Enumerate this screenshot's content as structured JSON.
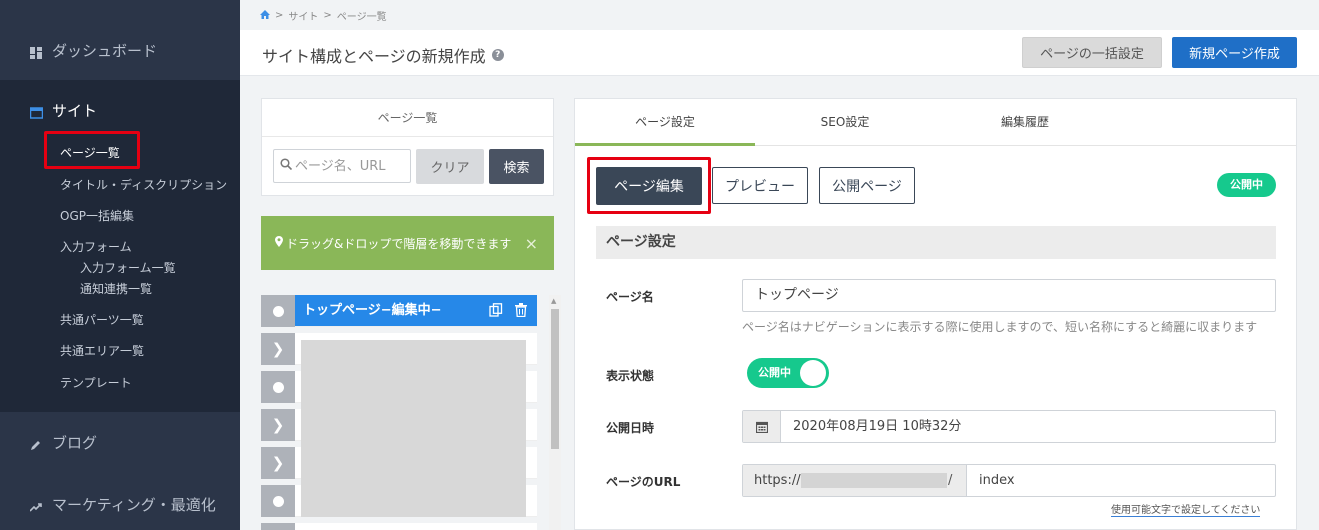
{
  "sidebar": {
    "dashboard": "ダッシュボード",
    "site": "サイト",
    "items": [
      {
        "label": "ページ一覧"
      },
      {
        "label": "タイトル・ディスクリプション"
      },
      {
        "label": "OGP一括編集"
      },
      {
        "label": "入力フォーム"
      },
      {
        "label": "入力フォーム一覧"
      },
      {
        "label": "通知連携一覧"
      },
      {
        "label": "共通パーツ一覧"
      },
      {
        "label": "共通エリア一覧"
      },
      {
        "label": "テンプレート"
      }
    ],
    "blog": "ブログ",
    "marketing": "マーケティング・最適化"
  },
  "breadcrumb": {
    "sep": ">",
    "site": "サイト",
    "current": "ページ一覧"
  },
  "header": {
    "title": "サイト構成とページの新規作成",
    "help": "?",
    "bulk_button": "ページの一括設定",
    "new_button": "新規ページ作成"
  },
  "page_list": {
    "title": "ページ一覧",
    "search_placeholder": "ページ名、URL",
    "clear_button": "クリア",
    "search_button": "検索"
  },
  "alert": {
    "text": "ドラッグ&ドロップで階層を移動できます",
    "close": "×"
  },
  "tree": {
    "active_label": "トップページ−編集中−"
  },
  "tabs": [
    {
      "label": "ページ設定"
    },
    {
      "label": "SEO設定"
    },
    {
      "label": "編集履歴"
    }
  ],
  "actions": {
    "edit": "ページ編集",
    "preview": "プレビュー",
    "public": "公開ページ",
    "status_badge": "公開中"
  },
  "settings": {
    "section_title": "ページ設定",
    "name_label": "ページ名",
    "name_value": "トップページ",
    "name_help": "ページ名はナビゲーションに表示する際に使用しますので、短い名称にすると綺麗に収まります",
    "status_label": "表示状態",
    "status_toggle": "公開中",
    "date_label": "公開日時",
    "date_value": "2020年08月19日 10時32分",
    "url_label": "ページのURL",
    "url_prefix": "https://",
    "url_slash": "/",
    "url_value": "index",
    "url_help": "使用可能文字で設定してください"
  },
  "colors": {
    "sidebar": "#2b3548",
    "primary": "#1f6fc7",
    "success": "#16c98d",
    "alert": "#8ab758",
    "highlight": "#e60012"
  }
}
